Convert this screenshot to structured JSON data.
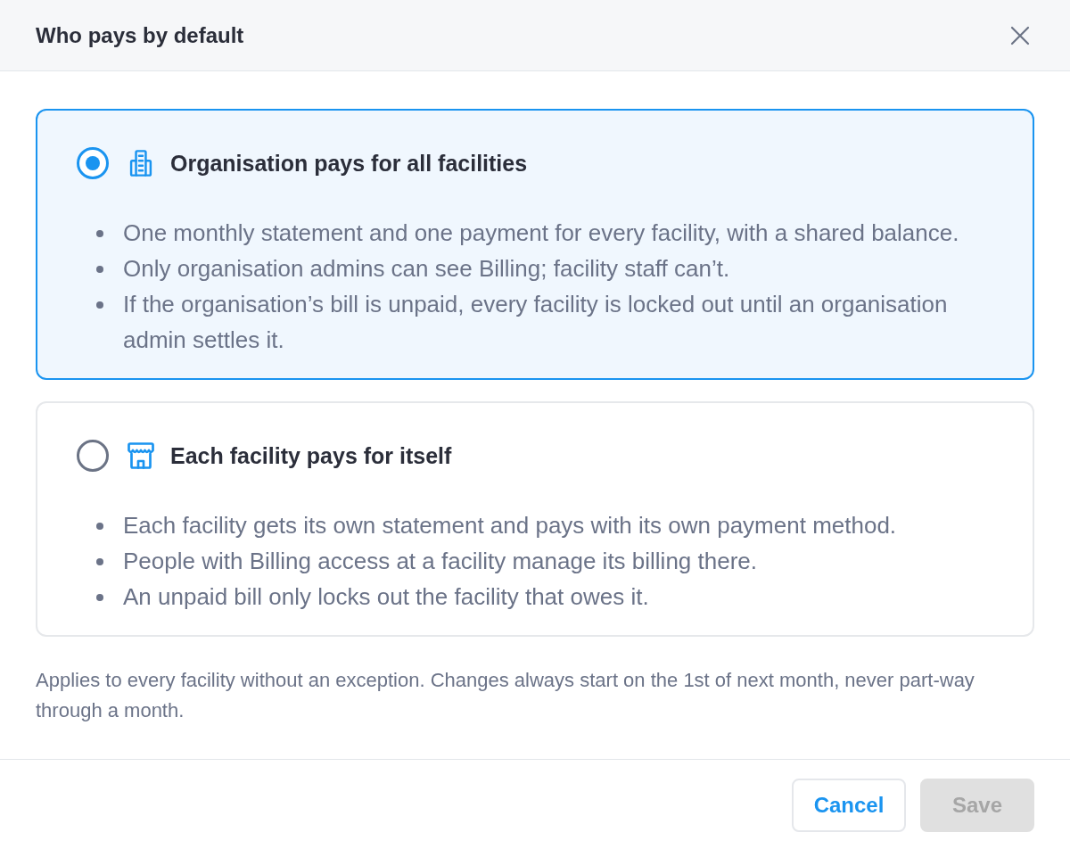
{
  "dialog": {
    "title": "Who pays by default"
  },
  "options": [
    {
      "kind": "organisation",
      "title": "Organisation pays for all facilities",
      "selected": true,
      "bullets": [
        "One monthly statement and one payment for every facility, with a shared balance.",
        "Only organisation admins can see Billing; facility staff can’t.",
        "If the organisation’s bill is unpaid, every facility is locked out until an organisation admin settles it."
      ]
    },
    {
      "kind": "facility",
      "title": "Each facility pays for itself",
      "selected": false,
      "bullets": [
        "Each facility gets its own statement and pays with its own payment method.",
        "People with Billing access at a facility manage its billing there.",
        "An unpaid bill only locks out the facility that owes it."
      ]
    }
  ],
  "note": "Applies to every facility without an exception. Changes always start on the 1st of next month, never part-way through a month.",
  "buttons": [
    {
      "kind": "secondary",
      "label": "Cancel",
      "disabled": false
    },
    {
      "kind": "primary",
      "label": "Save",
      "disabled": true
    }
  ]
}
